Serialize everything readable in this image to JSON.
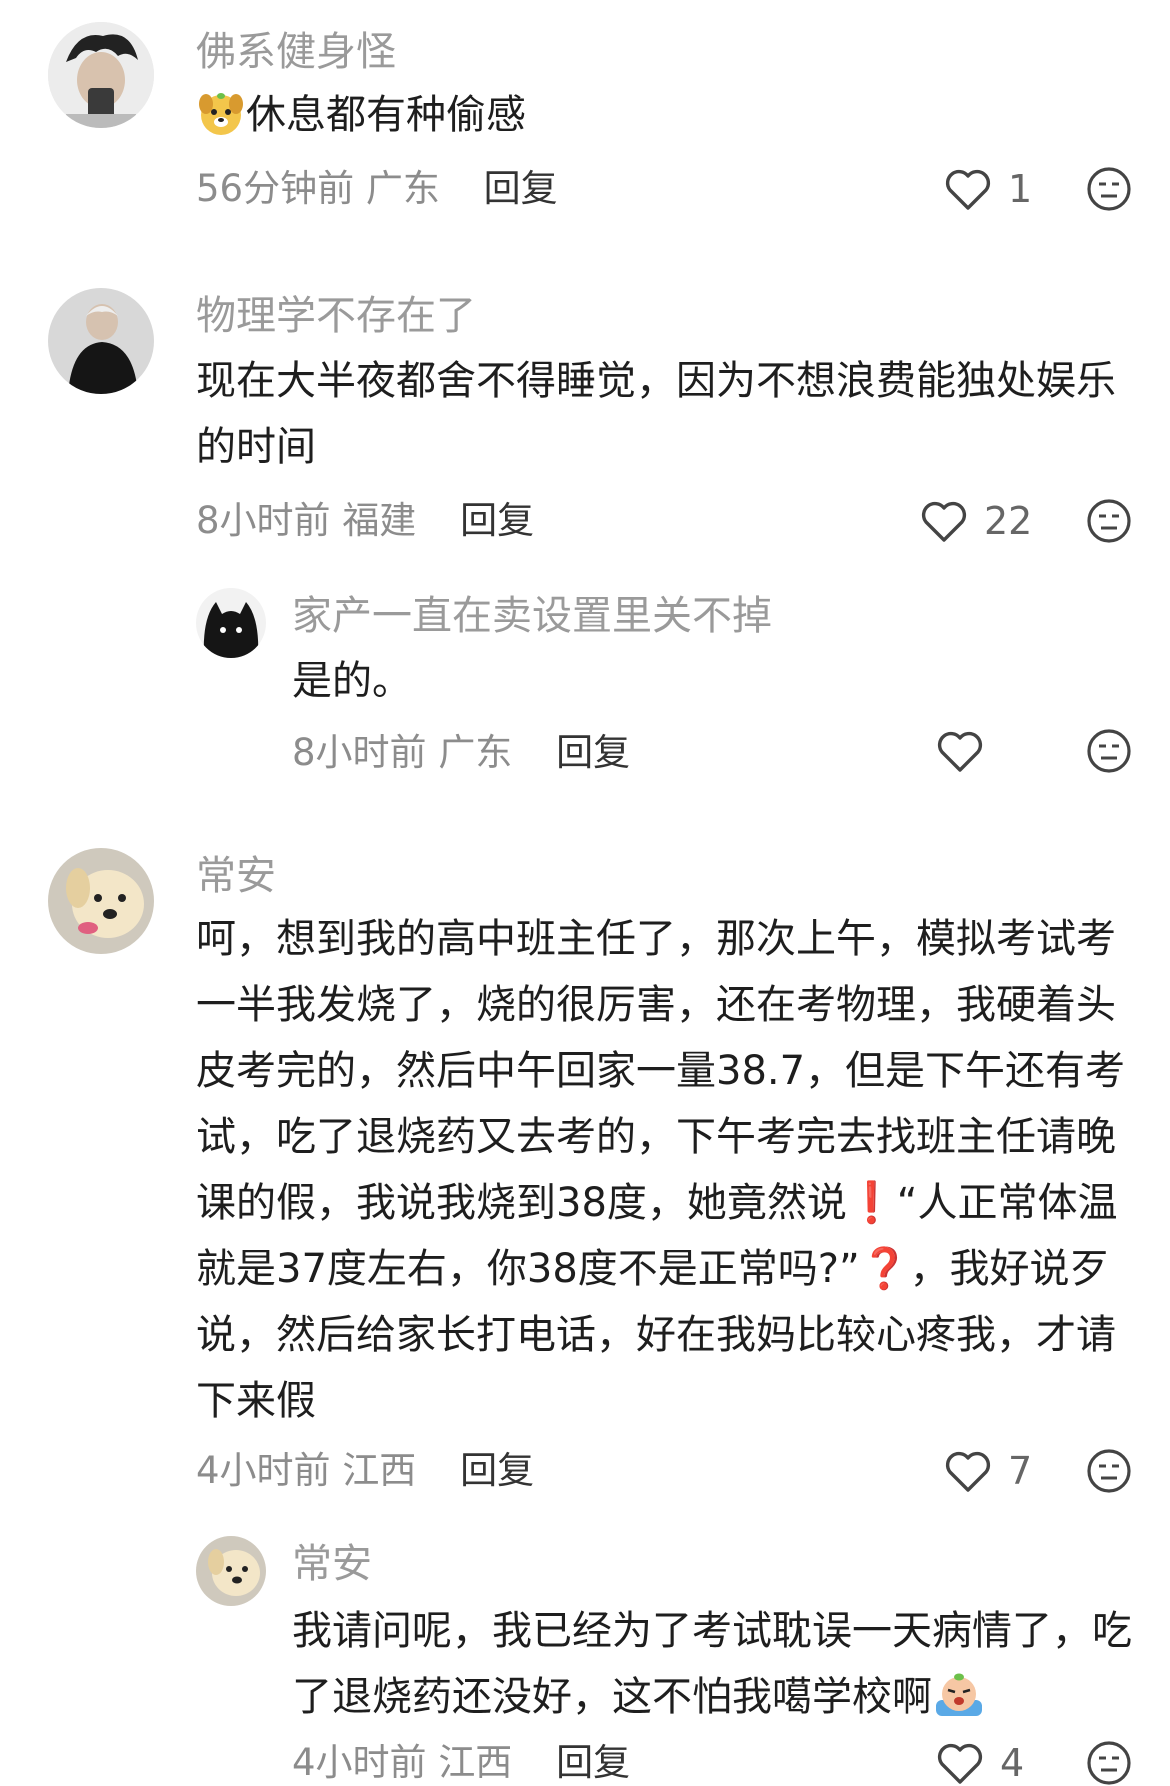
{
  "comments": [
    {
      "username": "佛系健身怪",
      "emoji_prefix": "dog-face-emoji",
      "text": "休息都有种偷感",
      "time": "56分钟前",
      "region": "广东",
      "reply_label": "回复",
      "likes": "1"
    },
    {
      "username": "物理学不存在了",
      "text": "现在大半夜都舍不得睡觉，因为不想浪费能独处娱乐的时间",
      "time": "8小时前",
      "region": "福建",
      "reply_label": "回复",
      "likes": "22",
      "reply": {
        "username": "家产一直在卖设置里关不掉",
        "text": "是的。",
        "time": "8小时前",
        "region": "广东",
        "reply_label": "回复",
        "likes": ""
      }
    },
    {
      "username": "常安",
      "text_part1": "呵，想到我的高中班主任了，那次上午，模拟考试考一半我发烧了，烧的很厉害，还在考物理，我硬着头皮考完的，然后中午回家一量38.7，但是下午还有考试，吃了退烧药又去考的，下午考完去找班主任请晚课的假，我说我烧到38度，她竟然说",
      "exclaim_mark": "❗",
      "text_part2": "“人正常体温就是37度左右，你38度不是正常吗?”",
      "question_mark": "❓",
      "text_part3": "，我好说歹说，然后给家长打电话，好在我妈比较心疼我，才请下来假",
      "time": "4小时前",
      "region": "江西",
      "reply_label": "回复",
      "likes": "7",
      "reply": {
        "username": "常安",
        "text": "我请问呢，我已经为了考试耽误一天病情了，吃了退烧药还没好，这不怕我噶学校啊",
        "emoji_suffix": "crying-emoji",
        "time": "4小时前",
        "region": "江西",
        "reply_label": "回复",
        "likes": "4"
      }
    }
  ],
  "colors": {
    "name": "#9a9a9a",
    "text": "#1e1e1e",
    "meta": "#8c8c8c",
    "accent_red": "#e0282a"
  }
}
